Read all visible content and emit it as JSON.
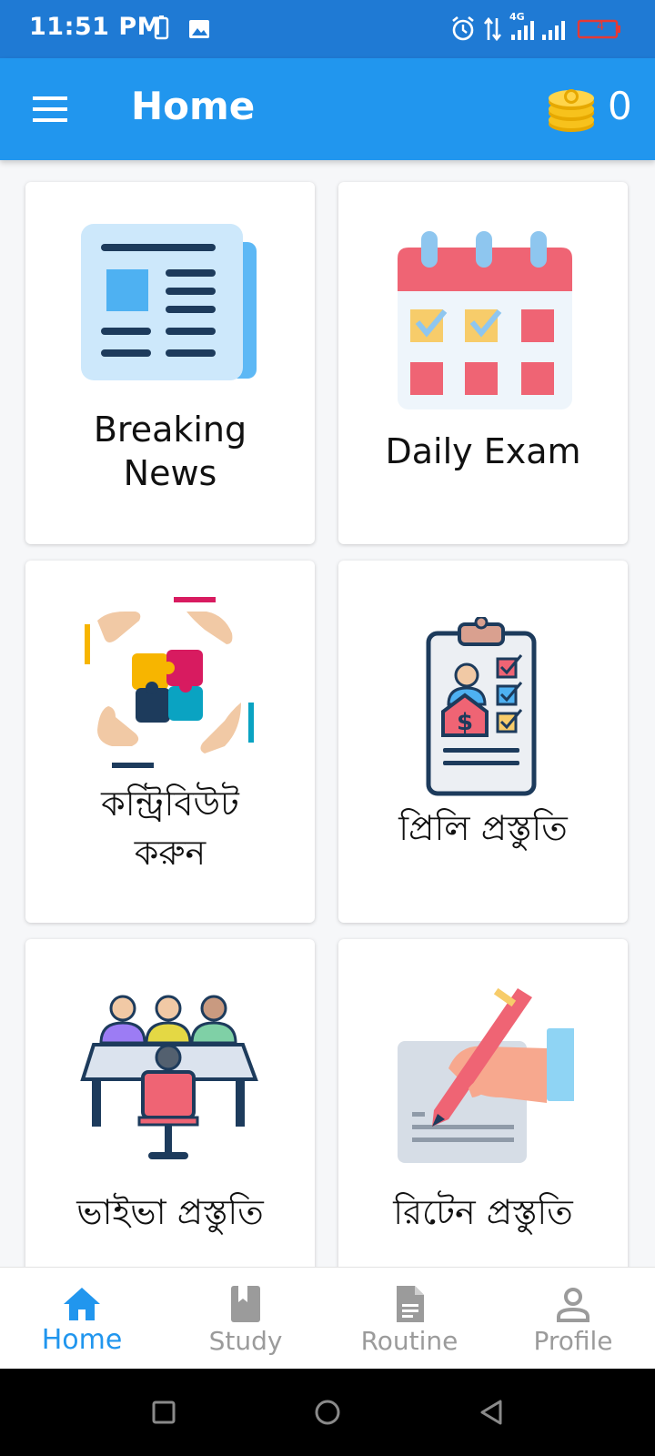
{
  "status_bar": {
    "time": "11:51 PM",
    "network": "4G",
    "battery": "4"
  },
  "app_bar": {
    "title": "Home",
    "coin_count": "0"
  },
  "cards": [
    {
      "label": "Breaking\nNews",
      "icon": "newspaper-icon"
    },
    {
      "label": "Daily Exam",
      "icon": "calendar-icon"
    },
    {
      "label": "কন্ট্রিবিউট\nকরুন",
      "icon": "puzzle-hands-icon"
    },
    {
      "label": "প্রিলি প্রস্তুতি",
      "icon": "clipboard-candidate-icon"
    },
    {
      "label": "ভাইভা প্রস্তুতি",
      "icon": "interview-board-icon"
    },
    {
      "label": "রিটেন প্রস্তুতি",
      "icon": "hand-writing-icon"
    }
  ],
  "bottom_nav": [
    {
      "label": "Home",
      "icon": "home-icon",
      "active": true
    },
    {
      "label": "Study",
      "icon": "book-icon",
      "active": false
    },
    {
      "label": "Routine",
      "icon": "document-icon",
      "active": false
    },
    {
      "label": "Profile",
      "icon": "person-icon",
      "active": false
    }
  ],
  "colors": {
    "status_bar": "#1f7ad4",
    "app_bar": "#2196ee",
    "nav_active": "#2196ee",
    "nav_inactive": "#9b9b9b"
  }
}
